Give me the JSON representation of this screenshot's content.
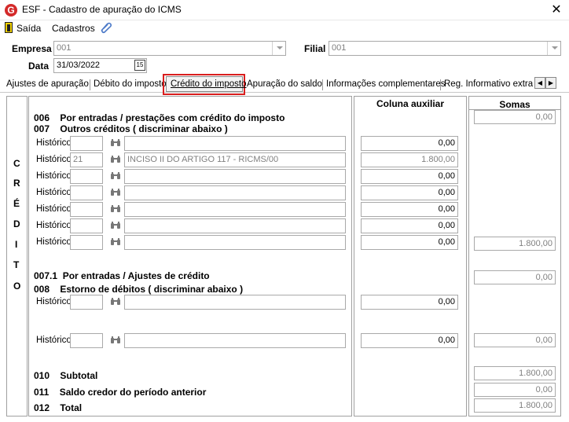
{
  "window": {
    "title": "ESF - Cadastro de apuração do ICMS",
    "logo_letter": "G",
    "close_glyph": "✕"
  },
  "menu": {
    "saida": "Saída",
    "cadastros": "Cadastros"
  },
  "header": {
    "empresa_label": "Empresa",
    "empresa_value": "001",
    "filial_label": "Filial",
    "filial_value": "001",
    "data_label": "Data",
    "data_value": "31/03/2022",
    "calendar_glyph": "15"
  },
  "tabs": [
    {
      "label": "Ajustes de apuração"
    },
    {
      "label": "Débito do imposto"
    },
    {
      "label": "Crédito do imposto"
    },
    {
      "label": "Apuração do saldo"
    },
    {
      "label": "Informações complementares"
    },
    {
      "label": "Reg. Informativo extra apu"
    }
  ],
  "tab_scroll": {
    "left": "◀",
    "right": "▶"
  },
  "side_letters": [
    "C",
    "R",
    "É",
    "D",
    "I",
    "T",
    "O"
  ],
  "columns": {
    "auxiliar": "Coluna auxiliar",
    "somas": "Somas"
  },
  "sections": {
    "s006": "006    Por entradas / prestações com crédito do imposto",
    "s007": "007    Outros créditos ( discriminar abaixo )",
    "s0071": "007.1  Por entradas / Ajustes de crédito",
    "s008": "008    Estorno de débitos ( discriminar abaixo )",
    "s010": "010    Subtotal",
    "s011": "011    Saldo credor do período anterior",
    "s012": "012    Total"
  },
  "historico_label": "Histórico",
  "outros_creditos": [
    {
      "code": "",
      "desc": "",
      "value": "0,00"
    },
    {
      "code": "21",
      "desc": "INCISO II DO ARTIGO 117 - RICMS/00",
      "value": "1.800,00"
    },
    {
      "code": "",
      "desc": "",
      "value": "0,00"
    },
    {
      "code": "",
      "desc": "",
      "value": "0,00"
    },
    {
      "code": "",
      "desc": "",
      "value": "0,00"
    },
    {
      "code": "",
      "desc": "",
      "value": "0,00"
    },
    {
      "code": "",
      "desc": "",
      "value": "0,00"
    }
  ],
  "estorno_debitos": [
    {
      "code": "",
      "desc": "",
      "value": "0,00"
    },
    {
      "code": "",
      "desc": "",
      "value": "0,00"
    }
  ],
  "somas": {
    "s006": "0,00",
    "s007": "1.800,00",
    "s0071": "0,00",
    "s008": "0,00",
    "s010": "1.800,00",
    "s011": "0,00",
    "s012": "1.800,00"
  }
}
